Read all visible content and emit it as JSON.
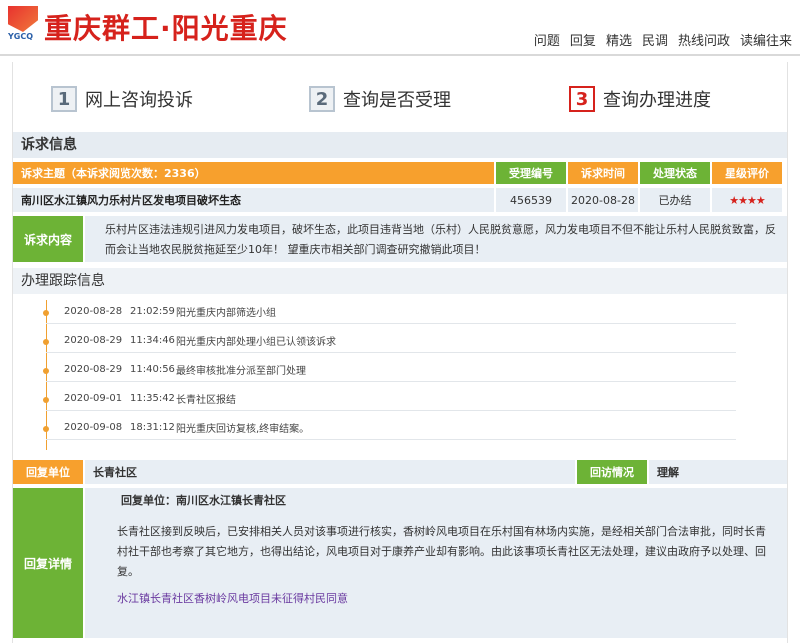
{
  "header": {
    "logo_text": "YGCQ",
    "site_title": "重庆群工·阳光重庆",
    "nav": [
      "问题",
      "回复",
      "精选",
      "民调",
      "热线问政",
      "读编往来"
    ]
  },
  "steps": [
    {
      "num": "1",
      "label": "网上咨询投诉"
    },
    {
      "num": "2",
      "label": "查询是否受理"
    },
    {
      "num": "3",
      "label": "查询办理进度"
    }
  ],
  "appeal": {
    "section_title": "诉求信息",
    "subject_header": "诉求主题（本诉求阅览次数：2336）",
    "col_id": "受理编号",
    "col_time": "诉求时间",
    "col_status": "处理状态",
    "col_rating": "星级评价",
    "subject": "南川区水江镇风力乐村片区发电项目破坏生态",
    "id": "456539",
    "time": "2020-08-28",
    "status": "已办结",
    "rating": "★★★★",
    "content_label": "诉求内容",
    "content": "乐村片区违法违规引进风力发电项目，破坏生态，此项目违背当地（乐村）人民脱贫意愿，风力发电项目不但不能让乐村人民脱贫致富，反而会让当地农民脱贫拖延至少10年！ 望重庆市相关部门调查研究撤销此项目！"
  },
  "tracking": {
    "section_title": "办理跟踪信息",
    "items": [
      {
        "date": "2020-08-28",
        "time": "21:02:59",
        "text": "阳光重庆内部筛选小组"
      },
      {
        "date": "2020-08-29",
        "time": "11:34:46",
        "text": "阳光重庆内部处理小组已认领该诉求"
      },
      {
        "date": "2020-08-29",
        "time": "11:40:56",
        "text": "最终审核批准分派至部门处理"
      },
      {
        "date": "2020-09-01",
        "time": "11:35:42",
        "text": "长青社区报结"
      },
      {
        "date": "2020-09-08",
        "time": "18:31:12",
        "text": "阳光重庆回访复核,终审结案。"
      }
    ]
  },
  "reply": {
    "unit_label": "回复单位",
    "unit": "长青社区",
    "visit_label": "回访情况",
    "visit": "理解",
    "detail_label": "回复详情",
    "detail_title": "回复单位：南川区水江镇长青社区",
    "detail_text": "长青社区接到反映后，已安排相关人员对该事项进行核实，香树岭风电项目在乐村国有林场内实施，是经相关部门合法审批，同时长青村社干部也考察了其它地方，也得出结论，风电项目对于康养产业却有影响。由此该事项长青社区无法处理，建议由政府予以处理、回复。",
    "detail_link": "水江镇长青社区香树岭风电项目未征得村民同意"
  }
}
